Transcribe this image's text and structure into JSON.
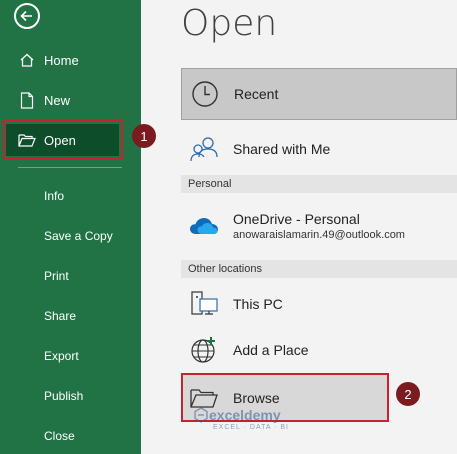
{
  "sidebar": {
    "back_icon": "back-arrow-icon",
    "accent": "#217346",
    "active_bg": "#0e4d29",
    "items": [
      {
        "label": "Home",
        "icon": "home-icon"
      },
      {
        "label": "New",
        "icon": "new-document-icon"
      },
      {
        "label": "Open",
        "icon": "folder-open-icon"
      }
    ],
    "plain_items": [
      "Info",
      "Save a Copy",
      "Print",
      "Share",
      "Export",
      "Publish",
      "Close"
    ]
  },
  "main": {
    "title": "Open",
    "recent_label": "Recent",
    "shared_label": "Shared with Me",
    "section_personal": "Personal",
    "onedrive_label": "OneDrive - Personal",
    "onedrive_email": "anowaraislamarin.49@outlook.com",
    "section_other": "Other locations",
    "thispc_label": "This PC",
    "addplace_label": "Add a Place",
    "browse_label": "Browse"
  },
  "annotations": {
    "badge1": "1",
    "badge2": "2",
    "highlight_color": "#c8202f",
    "badge_color": "#7b1b1f"
  },
  "watermark": {
    "name": "exceldemy",
    "tagline": "EXCEL · DATA · BI"
  }
}
